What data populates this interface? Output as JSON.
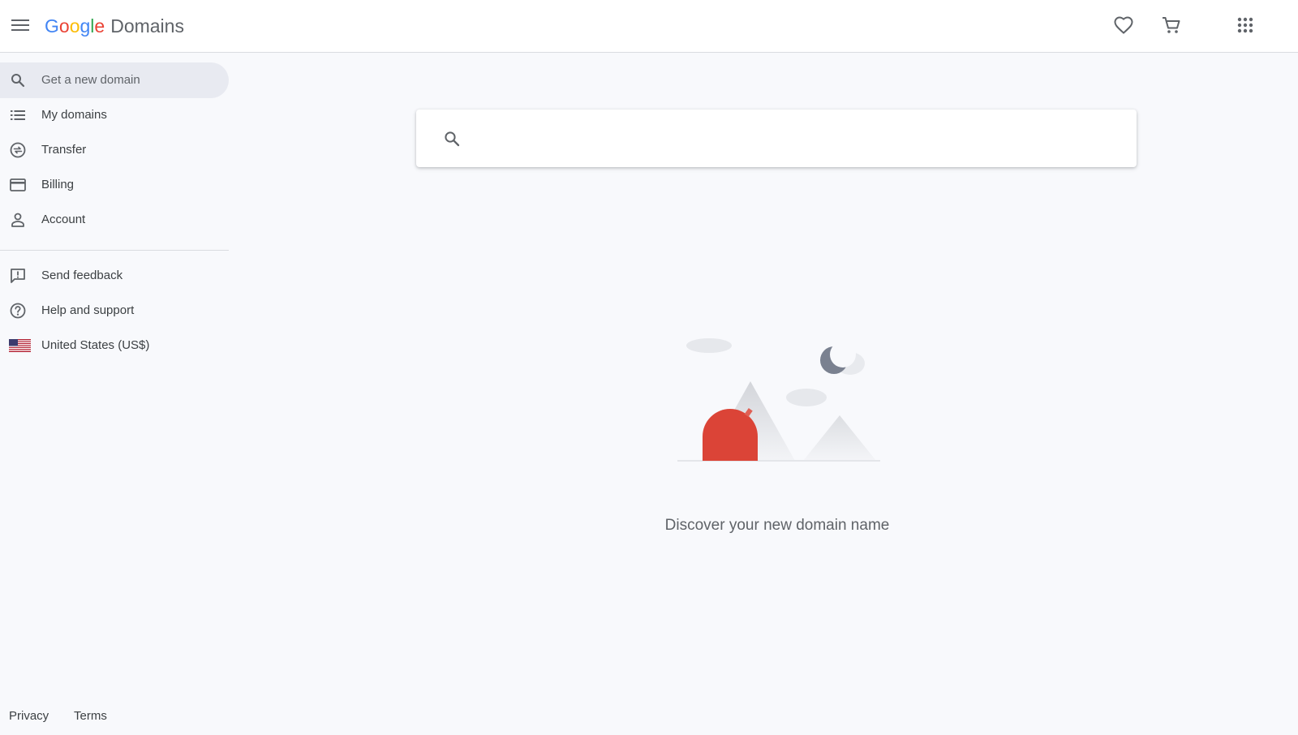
{
  "header": {
    "logo_letters": [
      "G",
      "o",
      "o",
      "g",
      "l",
      "e"
    ],
    "product_name": "Domains",
    "icons": {
      "menu": "hamburger-menu-icon",
      "favorites": "heart-icon",
      "cart": "shopping-cart-icon",
      "apps": "apps-grid-icon"
    }
  },
  "sidebar": {
    "items": [
      {
        "label": "Get a new domain",
        "icon": "search-icon",
        "active": true
      },
      {
        "label": "My domains",
        "icon": "list-icon",
        "active": false
      },
      {
        "label": "Transfer",
        "icon": "transfer-icon",
        "active": false
      },
      {
        "label": "Billing",
        "icon": "credit-card-icon",
        "active": false
      },
      {
        "label": "Account",
        "icon": "person-icon",
        "active": false
      }
    ],
    "secondary_items": [
      {
        "label": "Send feedback",
        "icon": "feedback-icon"
      },
      {
        "label": "Help and support",
        "icon": "help-icon"
      },
      {
        "label": "United States (US$)",
        "icon": "us-flag-icon"
      }
    ],
    "footer": {
      "privacy": "Privacy",
      "terms": "Terms"
    }
  },
  "main": {
    "search": {
      "value": "",
      "placeholder": ""
    },
    "empty_state": {
      "message": "Discover your new domain name"
    }
  },
  "colors": {
    "background": "#f8f9fc",
    "active_item_bg": "#e8eaf1",
    "accent_red": "#db4437",
    "icon_gray": "#5f6368"
  }
}
